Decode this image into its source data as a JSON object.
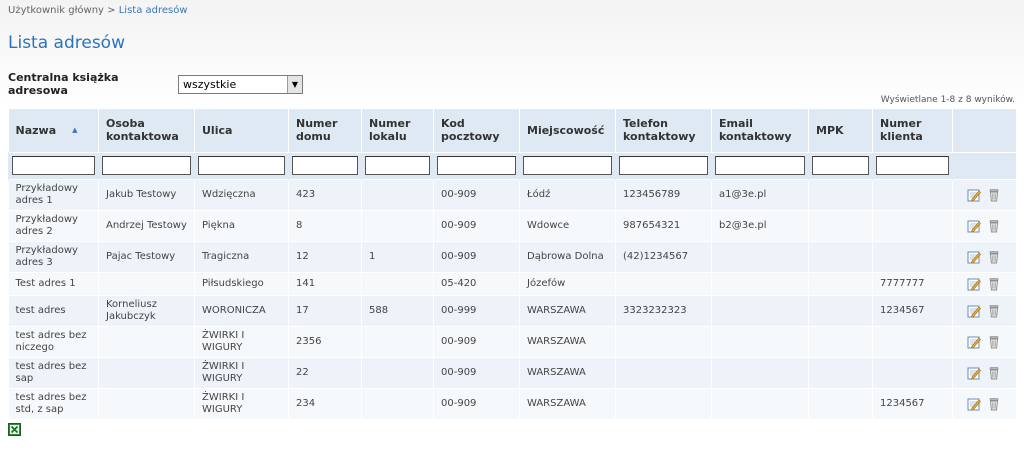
{
  "breadcrumb": {
    "root": "Użytkownik główny",
    "sep": ">",
    "current": "Lista adresów"
  },
  "page_title": "Lista adresów",
  "filter": {
    "label": "Centralna książka adresowa",
    "selected": "wszystkie"
  },
  "count_text": "Wyświetlane 1-8 z 8 wyników.",
  "columns": [
    "Nazwa",
    "Osoba kontaktowa",
    "Ulica",
    "Numer domu",
    "Numer lokalu",
    "Kod pocztowy",
    "Miejscowość",
    "Telefon kontaktowy",
    "Email kontaktowy",
    "MPK",
    "Numer klienta"
  ],
  "rows": [
    [
      "Przykładowy adres 1",
      "Jakub Testowy",
      "Wdzięczna",
      "423",
      "",
      "00-909",
      "Łódź",
      "123456789",
      "a1@3e.pl",
      "",
      ""
    ],
    [
      "Przykładowy adres 2",
      "Andrzej Testowy",
      "Piękna",
      "8",
      "",
      "00-909",
      "Wdowce",
      "987654321",
      "b2@3e.pl",
      "",
      ""
    ],
    [
      "Przykładowy adres 3",
      "Pajac Testowy",
      "Tragiczna",
      "12",
      "1",
      "00-909",
      "Dąbrowa Dolna",
      "(42)1234567",
      "",
      "",
      ""
    ],
    [
      "Test adres 1",
      "",
      "Piłsudskiego",
      "141",
      "",
      "05-420",
      "Józefów",
      "",
      "",
      "",
      "7777777"
    ],
    [
      "test adres",
      "Korneliusz Jakubczyk",
      "WORONICZA",
      "17",
      "588",
      "00-999",
      "WARSZAWA",
      "3323232323",
      "",
      "",
      "1234567"
    ],
    [
      "test adres bez niczego",
      "",
      "ŻWIRKI I WIGURY",
      "2356",
      "",
      "00-909",
      "WARSZAWA",
      "",
      "",
      "",
      ""
    ],
    [
      "test adres bez sap",
      "",
      "ŻWIRKI I WIGURY",
      "22",
      "",
      "00-909",
      "WARSZAWA",
      "",
      "",
      "",
      ""
    ],
    [
      "test adres bez std, z sap",
      "",
      "ŻWIRKI I WIGURY",
      "234",
      "",
      "00-909",
      "WARSZAWA",
      "",
      "",
      "",
      "1234567"
    ]
  ],
  "icons": {
    "edit": "edit-icon",
    "delete": "delete-icon",
    "export": "excel-export-icon",
    "sort": "sort-ascending-icon"
  },
  "colors": {
    "title": "#2a73c0",
    "header_bg": "#dfe9f3",
    "row_odd": "#eef3f9",
    "row_even": "#f6f9fc"
  }
}
